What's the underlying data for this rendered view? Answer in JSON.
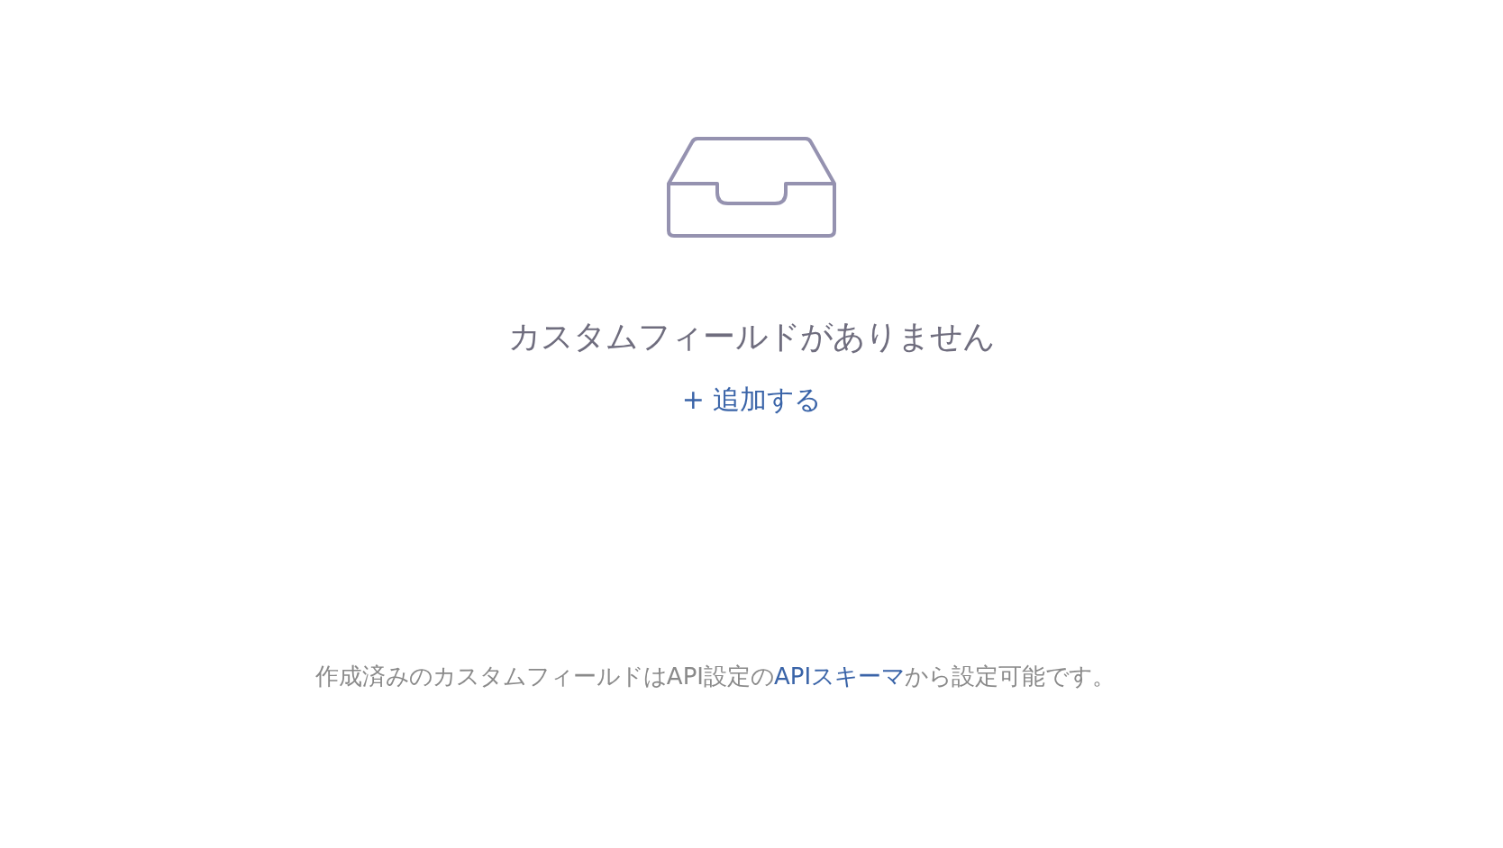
{
  "empty_state": {
    "title": "カスタムフィールドがありません",
    "add_link": "+ 追加する"
  },
  "footer": {
    "text_before": "作成済みのカスタムフィールドはAPI設定の",
    "link": "APIスキーマ",
    "text_after": "から設定可能です。"
  }
}
